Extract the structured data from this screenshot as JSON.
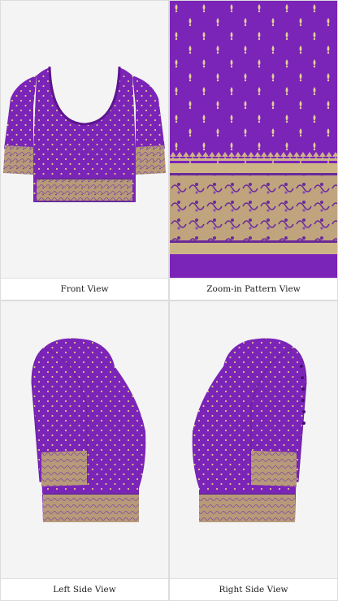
{
  "views": [
    {
      "id": "front",
      "label": "Front View"
    },
    {
      "id": "zoom",
      "label": "Zoom-in Pattern View"
    },
    {
      "id": "left",
      "label": "Left Side View"
    },
    {
      "id": "right",
      "label": "Right Side View"
    }
  ],
  "colors": {
    "silk": "#7b24b8",
    "silk_dark": "#5d1590",
    "motif": "#d9c48a",
    "border_gold": "#b89a78",
    "border_purple": "#6a2a9a",
    "background": "#f4f4f4"
  },
  "icons": [
    "blouse-front-image",
    "pattern-zoom-image",
    "blouse-left-image",
    "blouse-right-image",
    "hook-button-icon"
  ]
}
